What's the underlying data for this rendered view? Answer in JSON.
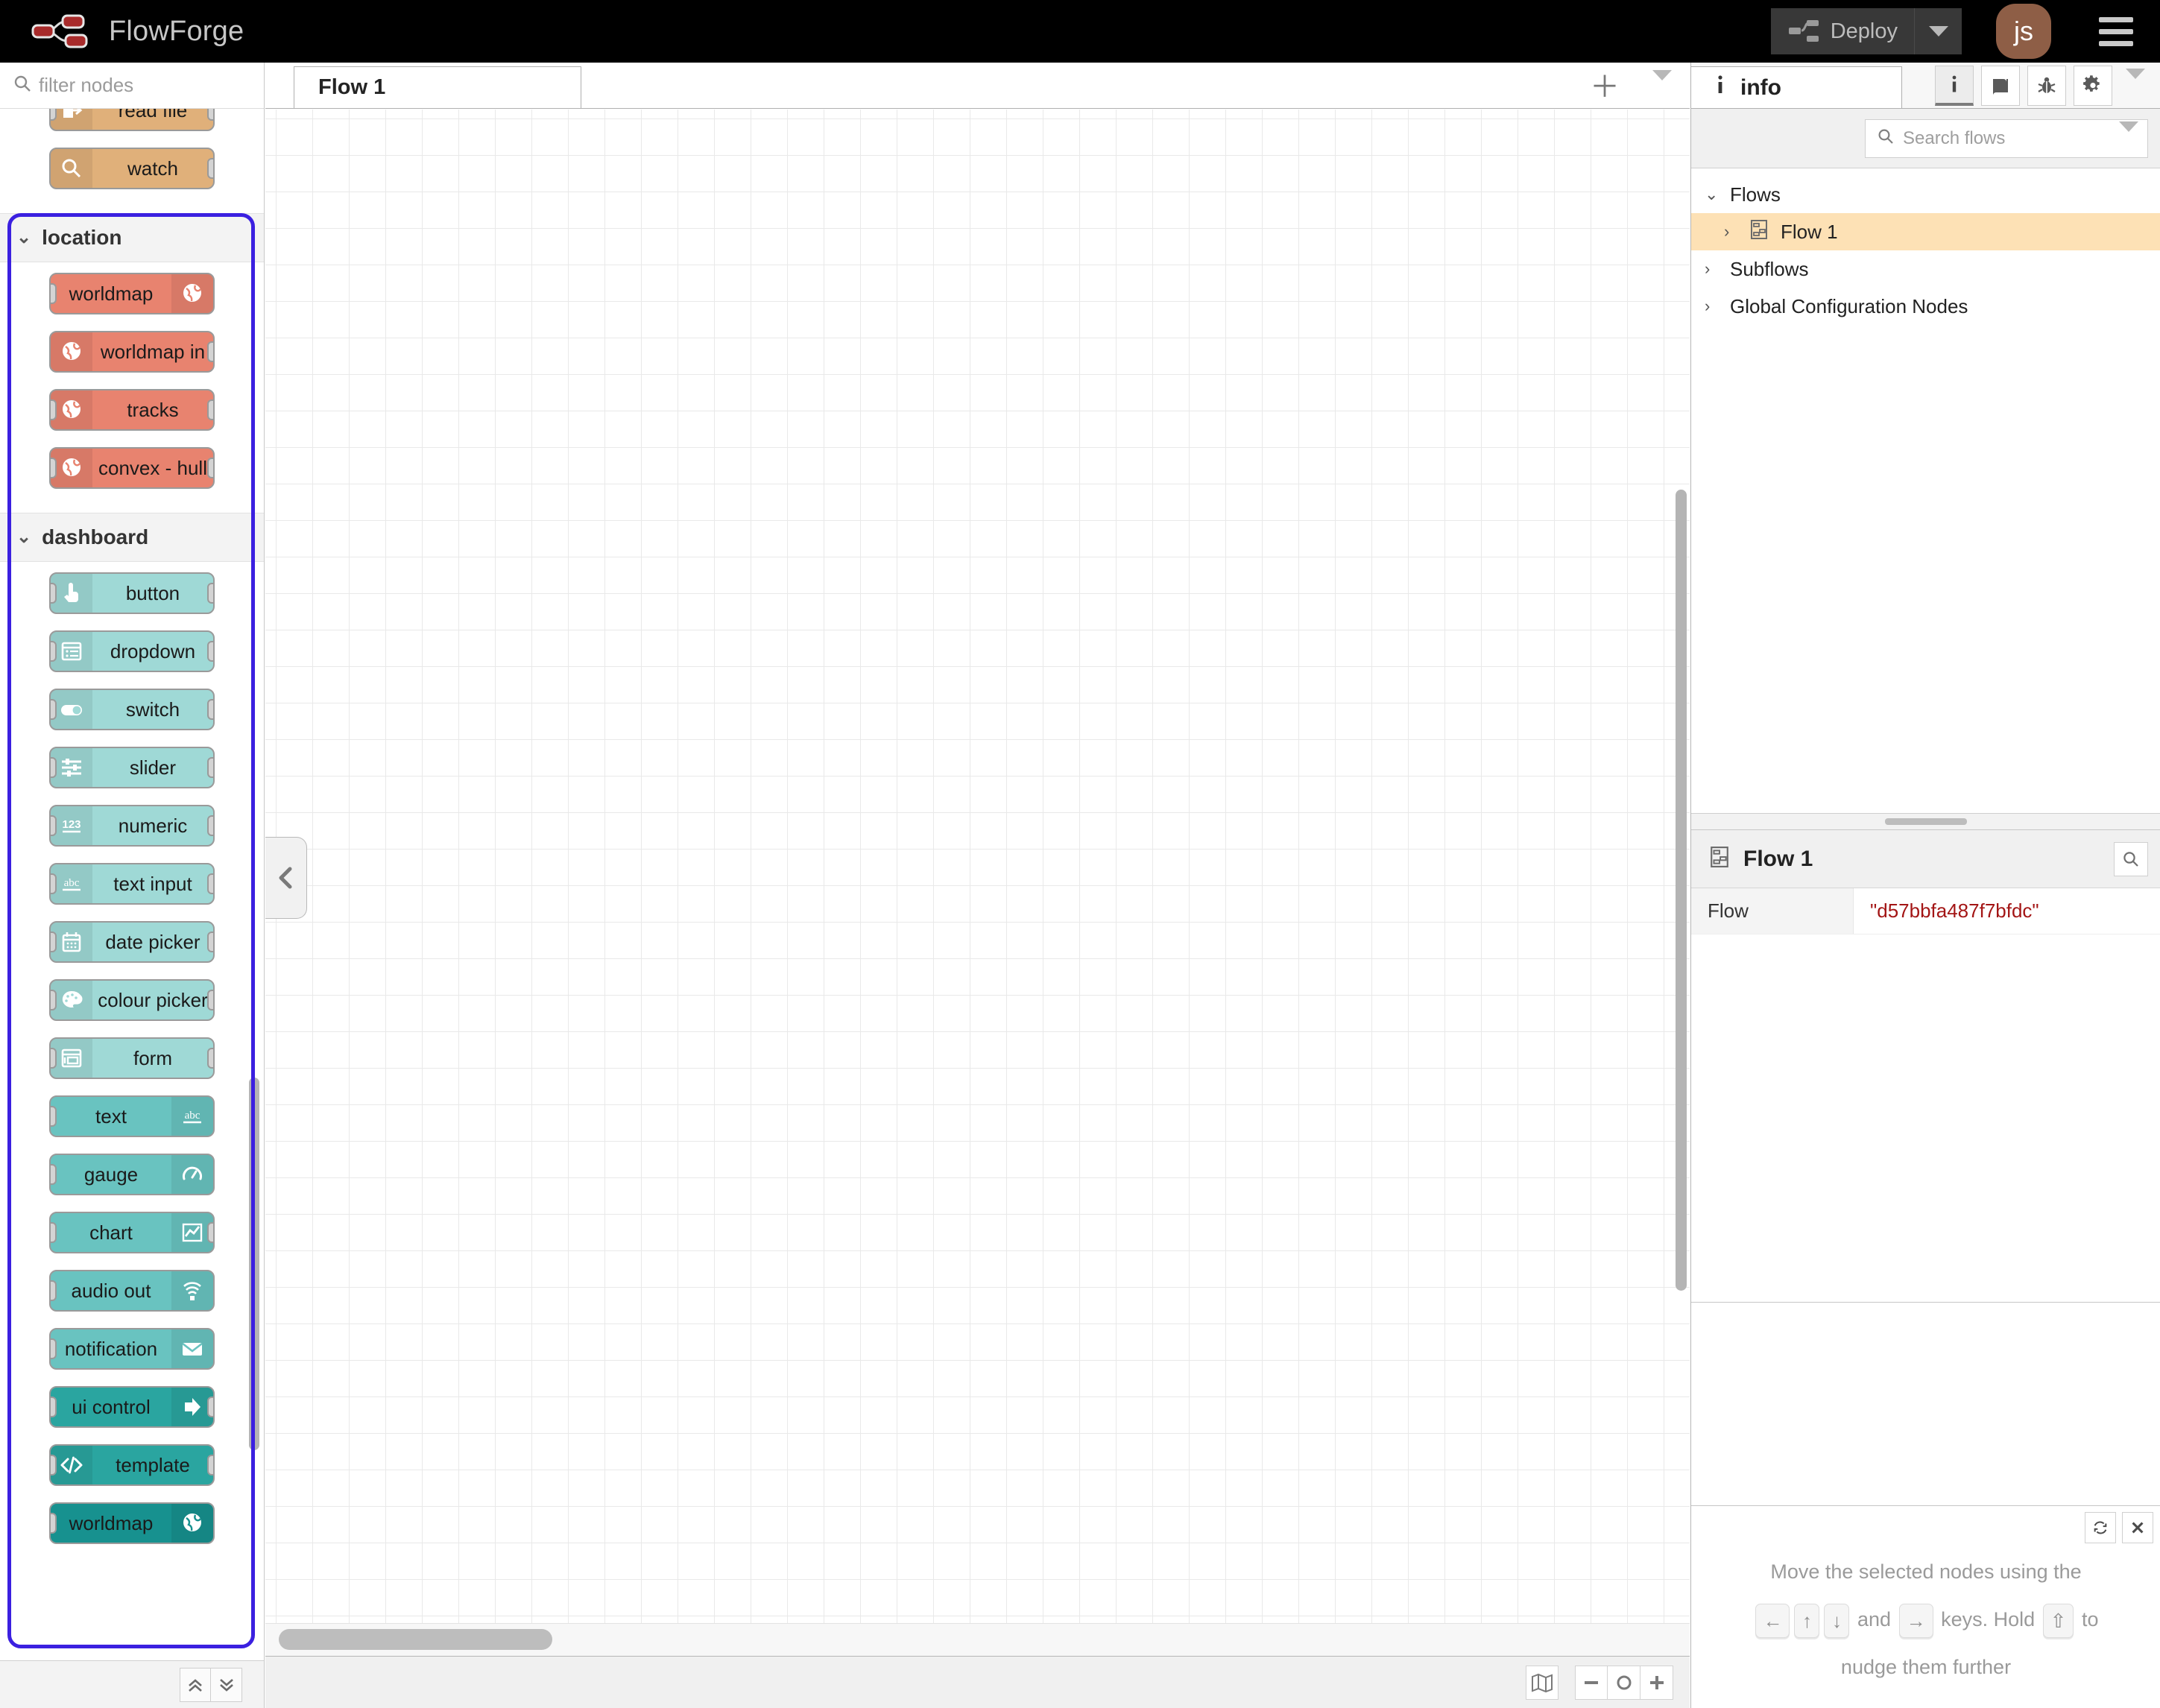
{
  "app": {
    "title": "FlowForge",
    "logo_icon": "flow-nodes-logo"
  },
  "header": {
    "deploy_label": "Deploy",
    "deploy_icon": "deploy-flow-icon",
    "deploy_caret_icon": "chevron-down-icon",
    "avatar_initials": "js",
    "avatar_color": "#8e5e46",
    "menu_icon": "hamburger-menu-icon"
  },
  "palette": {
    "search_placeholder": "filter nodes",
    "search_icon": "search-icon",
    "collapse_icon": "chevron-left-icon",
    "footer": {
      "collapse_all_icon": "chevrons-up-icon",
      "expand_all_icon": "chevrons-down-icon"
    },
    "partial_top": [
      {
        "label": "read file",
        "icon": "file-export-icon",
        "color": "#e0b07a",
        "icon_side": "left",
        "ports": {
          "in": true,
          "out": true
        }
      },
      {
        "label": "watch",
        "icon": "search-icon",
        "color": "#e0b07a",
        "icon_side": "left",
        "ports": {
          "in": false,
          "out": true
        }
      }
    ],
    "categories": [
      {
        "name": "location",
        "chevron": "chevron-down-icon",
        "highlighted": true,
        "nodes": [
          {
            "label": "worldmap",
            "icon": "globe-icon",
            "color": "#e8836f",
            "icon_side": "right",
            "ports": {
              "in": true,
              "out": false
            }
          },
          {
            "label": "worldmap in",
            "icon": "globe-icon",
            "color": "#e8836f",
            "icon_side": "left",
            "ports": {
              "in": false,
              "out": true
            }
          },
          {
            "label": "tracks",
            "icon": "globe-icon",
            "color": "#e8836f",
            "icon_side": "left",
            "ports": {
              "in": true,
              "out": true
            }
          },
          {
            "label": "convex - hull",
            "icon": "globe-icon",
            "color": "#e8836f",
            "icon_side": "left",
            "ports": {
              "in": true,
              "out": true
            }
          }
        ]
      },
      {
        "name": "dashboard",
        "chevron": "chevron-down-icon",
        "highlighted": true,
        "nodes": [
          {
            "label": "button",
            "icon": "pointer-hand-icon",
            "color": "#9fd9d6",
            "icon_side": "left",
            "ports": {
              "in": true,
              "out": true
            }
          },
          {
            "label": "dropdown",
            "icon": "list-box-icon",
            "color": "#9fd9d6",
            "icon_side": "left",
            "ports": {
              "in": true,
              "out": true
            }
          },
          {
            "label": "switch",
            "icon": "toggle-switch-icon",
            "color": "#9fd9d6",
            "icon_side": "left",
            "ports": {
              "in": true,
              "out": true
            }
          },
          {
            "label": "slider",
            "icon": "sliders-icon",
            "color": "#9fd9d6",
            "icon_side": "left",
            "ports": {
              "in": true,
              "out": true
            }
          },
          {
            "label": "numeric",
            "icon": "numbers-123-icon",
            "color": "#9fd9d6",
            "icon_side": "left",
            "ports": {
              "in": true,
              "out": true
            }
          },
          {
            "label": "text input",
            "icon": "abc-text-icon",
            "color": "#9fd9d6",
            "icon_side": "left",
            "ports": {
              "in": true,
              "out": true
            }
          },
          {
            "label": "date picker",
            "icon": "calendar-icon",
            "color": "#9fd9d6",
            "icon_side": "left",
            "ports": {
              "in": true,
              "out": true
            }
          },
          {
            "label": "colour picker",
            "icon": "palette-icon",
            "color": "#9fd9d6",
            "icon_side": "left",
            "ports": {
              "in": true,
              "out": true
            }
          },
          {
            "label": "form",
            "icon": "form-window-icon",
            "color": "#9fd9d6",
            "icon_side": "left",
            "ports": {
              "in": true,
              "out": true
            }
          },
          {
            "label": "text",
            "icon": "abc-text-icon",
            "color": "#69c3c0",
            "icon_side": "right",
            "ports": {
              "in": true,
              "out": false
            }
          },
          {
            "label": "gauge",
            "icon": "gauge-icon",
            "color": "#69c3c0",
            "icon_side": "right",
            "ports": {
              "in": true,
              "out": false
            }
          },
          {
            "label": "chart",
            "icon": "line-chart-icon",
            "color": "#69c3c0",
            "icon_side": "right",
            "ports": {
              "in": true,
              "out": true
            }
          },
          {
            "label": "audio out",
            "icon": "audio-wave-icon",
            "color": "#69c3c0",
            "icon_side": "right",
            "ports": {
              "in": true,
              "out": false
            }
          },
          {
            "label": "notification",
            "icon": "envelope-icon",
            "color": "#69c3c0",
            "icon_side": "right",
            "ports": {
              "in": true,
              "out": false
            }
          },
          {
            "label": "ui control",
            "icon": "arrow-right-icon",
            "color": "#2aa5a0",
            "icon_side": "right",
            "ports": {
              "in": true,
              "out": true
            }
          },
          {
            "label": "template",
            "icon": "code-brackets-icon",
            "color": "#2aa5a0",
            "icon_side": "left",
            "ports": {
              "in": true,
              "out": true
            }
          },
          {
            "label": "worldmap",
            "icon": "globe-icon",
            "color": "#17918f",
            "icon_side": "right",
            "ports": {
              "in": true,
              "out": false
            }
          }
        ]
      }
    ],
    "selection_border_color": "#3b20e0"
  },
  "workspace": {
    "tabs": [
      {
        "label": "Flow 1",
        "active": true
      }
    ],
    "add_tab_icon": "plus-icon",
    "tab_menu_icon": "chevron-down-icon",
    "footer": {
      "navigator_icon": "map-icon",
      "zoom_out_icon": "minus-icon",
      "zoom_reset_icon": "circle-icon",
      "zoom_in_icon": "plus-icon"
    }
  },
  "sidebar": {
    "tab": {
      "label": "info",
      "icon": "info-icon"
    },
    "icons": [
      {
        "name": "info-icon",
        "active": true
      },
      {
        "name": "book-help-icon",
        "active": false
      },
      {
        "name": "bug-debug-icon",
        "active": false
      },
      {
        "name": "gear-settings-icon",
        "active": false
      }
    ],
    "more_icon": "chevron-down-icon",
    "search": {
      "placeholder": "Search flows",
      "icon": "search-icon",
      "caret_icon": "chevron-down-icon"
    },
    "tree": [
      {
        "label": "Flows",
        "chevron": "chevron-down-icon",
        "level": 0,
        "selected": false,
        "icon": null
      },
      {
        "label": "Flow 1",
        "chevron": "chevron-right-icon",
        "level": 1,
        "selected": true,
        "icon": "flow-icon"
      },
      {
        "label": "Subflows",
        "chevron": "chevron-right-icon",
        "level": 0,
        "selected": false,
        "icon": null
      },
      {
        "label": "Global Configuration Nodes",
        "chevron": "chevron-right-icon",
        "level": 0,
        "selected": false,
        "icon": null
      }
    ],
    "detail": {
      "title": "Flow 1",
      "title_icon": "flow-icon",
      "search_icon": "search-icon",
      "properties": [
        {
          "key": "Flow",
          "value": "\"d57bbfa487f7bfdc\"",
          "value_color": "#a31515"
        }
      ]
    },
    "tip": {
      "refresh_icon": "refresh-icon",
      "close_icon": "close-x-icon",
      "line1": "Move the selected nodes using the",
      "keys_group1": [
        "←",
        "↑",
        "↓"
      ],
      "and_text": "and",
      "keys_group2": [
        "→"
      ],
      "mid_text": "keys. Hold",
      "keys_group3": [
        "⇧"
      ],
      "to_text": "to",
      "line3": "nudge them further"
    }
  }
}
